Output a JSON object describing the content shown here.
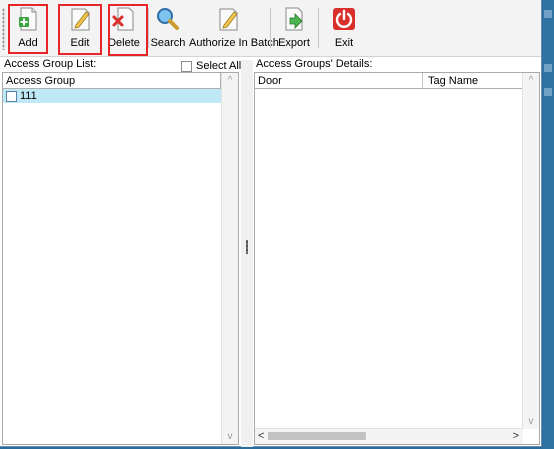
{
  "toolbar": {
    "buttons": [
      {
        "label": "Add",
        "icon": "add-document-icon"
      },
      {
        "label": "Edit",
        "icon": "edit-pencil-icon"
      },
      {
        "label": "Delete",
        "icon": "delete-document-icon"
      },
      {
        "label": "Search",
        "icon": "search-magnifier-icon"
      },
      {
        "label": "Authorize In Batch",
        "icon": "authorize-pencil-icon"
      },
      {
        "label": "Export",
        "icon": "export-arrow-icon"
      },
      {
        "label": "Exit",
        "icon": "power-icon"
      }
    ],
    "highlight_color": "#e8262a"
  },
  "left_panel": {
    "title": "Access Group List:",
    "select_all_label": "Select All",
    "column_header": "Access Group",
    "rows": [
      {
        "name": "111",
        "checked": false,
        "selected": true
      }
    ]
  },
  "right_panel": {
    "title": "Access Groups' Details:",
    "columns": [
      "Door",
      "Tag Name"
    ]
  },
  "colors": {
    "selected_row": "#bfe9f5",
    "exit_red": "#d9302c",
    "add_green": "#3aa642",
    "window_bg": "#2a6c9c"
  }
}
